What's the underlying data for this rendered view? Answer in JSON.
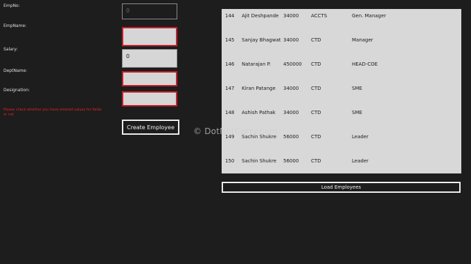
{
  "form": {
    "empno": {
      "label": "EmpNo:",
      "value": "0"
    },
    "empname": {
      "label": "EmpName:",
      "value": ""
    },
    "salary": {
      "label": "Salary:",
      "value": "0"
    },
    "deptname": {
      "label": "DeptName:",
      "value": ""
    },
    "designation": {
      "label": "Designation:",
      "value": ""
    },
    "error_message": "Please check whether you have entered values for fields or not",
    "create_button_label": "Create Employee",
    "colors": {
      "error": "#e02020",
      "invalid_border": "#c51f2a"
    }
  },
  "employees": [
    {
      "id": "144",
      "name": "Ajit Deshpande",
      "salary": "34000",
      "dept": "ACCTS",
      "designation": "Gen. Manager"
    },
    {
      "id": "145",
      "name": "Sanjay Bhagwat",
      "salary": "34000",
      "dept": "CTD",
      "designation": "Manager"
    },
    {
      "id": "146",
      "name": "Natarajan P.",
      "salary": "450000",
      "dept": "CTD",
      "designation": "HEAD-COE"
    },
    {
      "id": "147",
      "name": "Kiran Patange",
      "salary": "34000",
      "dept": "CTD",
      "designation": "SME"
    },
    {
      "id": "148",
      "name": "Ashish Pathak",
      "salary": "34000",
      "dept": "CTD",
      "designation": "SME"
    },
    {
      "id": "149",
      "name": "Sachin Shukre",
      "salary": "56000",
      "dept": "CTD",
      "designation": "Leader"
    },
    {
      "id": "150",
      "name": "Sachin Shukre",
      "salary": "56000",
      "dept": "CTD",
      "designation": "Leader"
    }
  ],
  "load_button_label": "Load Employees",
  "watermark": "© DotNetCurry.com"
}
